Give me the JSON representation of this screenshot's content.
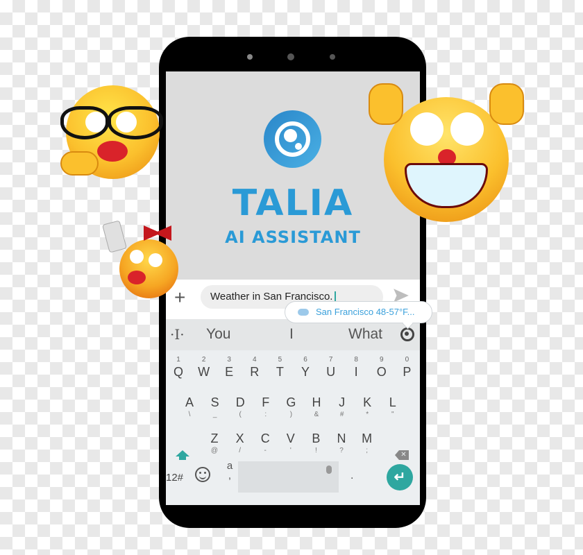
{
  "app": {
    "brand_title": "TALIA",
    "brand_subtitle": "AI ASSISTANT",
    "logo_icon": "talia-logo-icon",
    "accent_color": "#2a9ad6"
  },
  "compose": {
    "add_icon": "+",
    "input_value": "Weather in San Francisco.",
    "send_icon": "send-icon"
  },
  "suggestion_popup": {
    "icon": "cloud-rain-icon",
    "text": "San Francisco 48-57°F..."
  },
  "suggestion_strip": {
    "cursor_icon": "·I·",
    "suggestions": [
      "You",
      "I",
      "What"
    ],
    "assistant_icon": "talia-icon"
  },
  "keyboard": {
    "row1": [
      {
        "key": "Q",
        "hint": "1"
      },
      {
        "key": "W",
        "hint": "2"
      },
      {
        "key": "E",
        "hint": "3"
      },
      {
        "key": "R",
        "hint": "4"
      },
      {
        "key": "T",
        "hint": "5"
      },
      {
        "key": "Y",
        "hint": "6"
      },
      {
        "key": "U",
        "hint": "7"
      },
      {
        "key": "I",
        "hint": "8"
      },
      {
        "key": "O",
        "hint": "9"
      },
      {
        "key": "P",
        "hint": "0"
      }
    ],
    "row2": [
      {
        "key": "A",
        "sub": "\\"
      },
      {
        "key": "S",
        "sub": "_"
      },
      {
        "key": "D",
        "sub": "("
      },
      {
        "key": "F",
        "sub": ":"
      },
      {
        "key": "G",
        "sub": ")"
      },
      {
        "key": "H",
        "sub": "&"
      },
      {
        "key": "J",
        "sub": "#"
      },
      {
        "key": "K",
        "sub": "*"
      },
      {
        "key": "L",
        "sub": "\""
      }
    ],
    "row3": [
      {
        "key": "Z",
        "sub": "@"
      },
      {
        "key": "X",
        "sub": "/"
      },
      {
        "key": "C",
        "sub": "-"
      },
      {
        "key": "V",
        "sub": "'"
      },
      {
        "key": "B",
        "sub": "!"
      },
      {
        "key": "N",
        "sub": "?"
      },
      {
        "key": "M",
        "sub": ";"
      }
    ],
    "num_key": "12#",
    "lang_key_top": "a",
    "lang_key_bottom": ",",
    "period_key": ".",
    "enter_icon": "↵",
    "backspace_icon": "✕"
  },
  "decorations": {
    "emojis": [
      "emoji-glasses-kiss",
      "emoji-clown-grin",
      "emoji-bow-selfie"
    ]
  }
}
